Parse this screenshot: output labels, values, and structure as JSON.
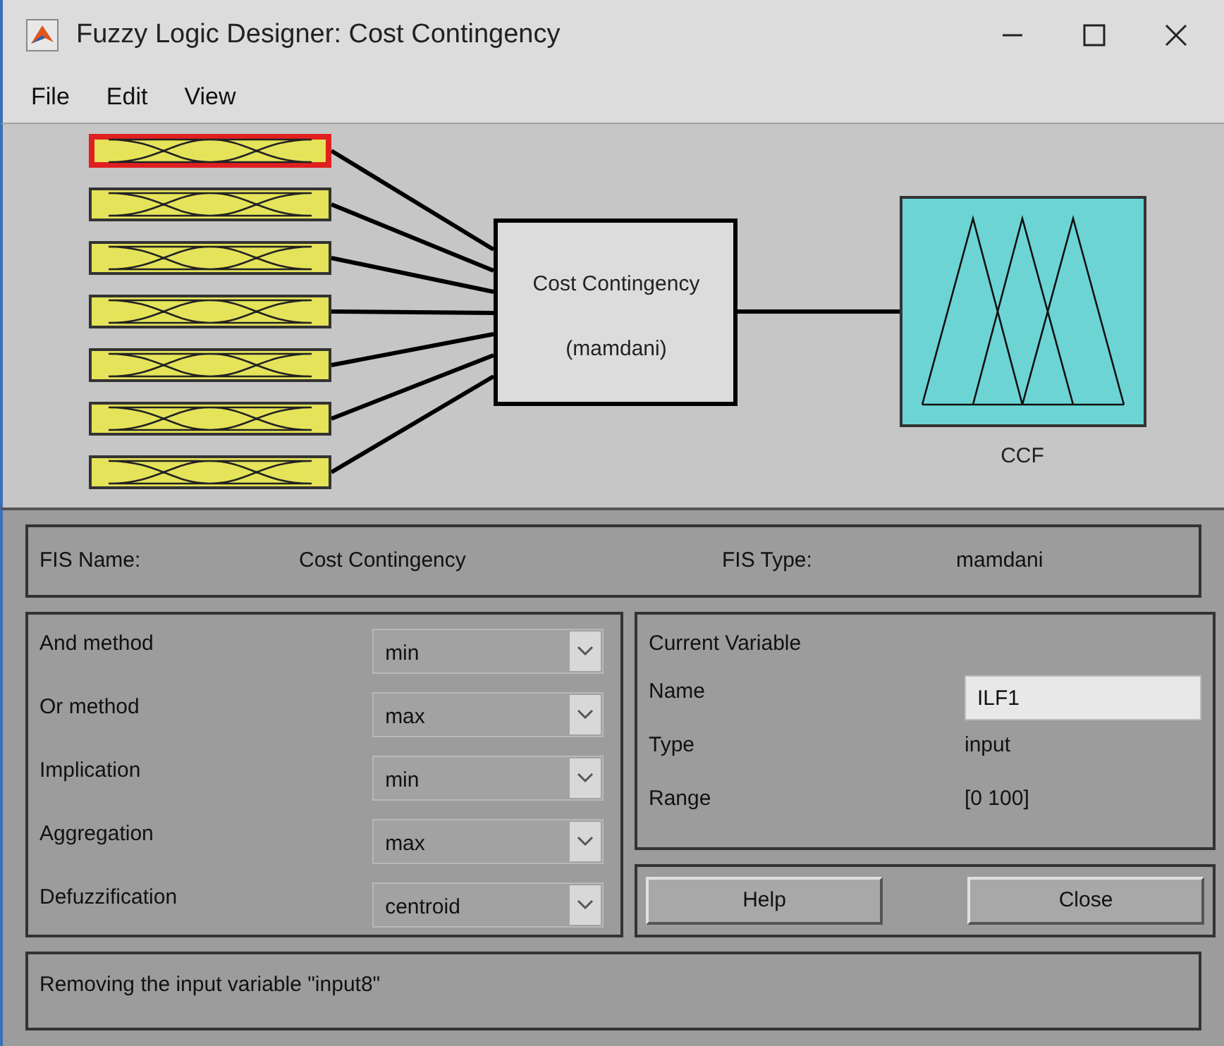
{
  "window": {
    "title": "Fuzzy Logic Designer: Cost Contingency"
  },
  "menu": [
    "File",
    "Edit",
    "View"
  ],
  "diagram": {
    "inputs": [
      {
        "selected": true
      },
      {
        "selected": false
      },
      {
        "selected": false
      },
      {
        "selected": false
      },
      {
        "selected": false
      },
      {
        "selected": false
      },
      {
        "selected": false
      }
    ],
    "system": {
      "name": "Cost Contingency",
      "type": "(mamdani)"
    },
    "output": {
      "name": "CCF"
    }
  },
  "fis": {
    "name_label": "FIS Name:",
    "name": "Cost Contingency",
    "type_label": "FIS Type:",
    "type": "mamdani"
  },
  "methods": [
    {
      "label": "And method",
      "value": "min"
    },
    {
      "label": "Or method",
      "value": "max"
    },
    {
      "label": "Implication",
      "value": "min"
    },
    {
      "label": "Aggregation",
      "value": "max"
    },
    {
      "label": "Defuzzification",
      "value": "centroid"
    }
  ],
  "current_variable": {
    "title": "Current Variable",
    "name_label": "Name",
    "name": "ILF1",
    "type_label": "Type",
    "type": "input",
    "range_label": "Range",
    "range": "[0 100]"
  },
  "buttons": [
    "Help",
    "Close"
  ],
  "status": "Removing the input variable \"input8\""
}
